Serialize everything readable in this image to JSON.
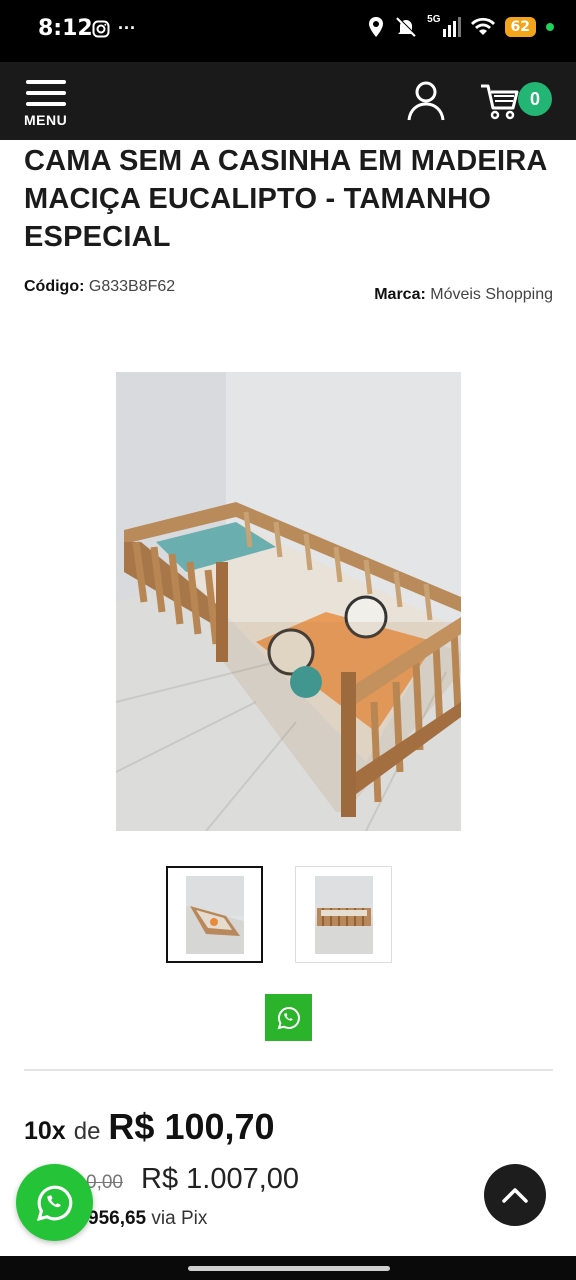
{
  "status_bar": {
    "time": "8:12",
    "network": "5G",
    "battery": "62",
    "overflow": "···"
  },
  "header": {
    "menu_label": "MENU",
    "cart_count": "0"
  },
  "product": {
    "title": "CAMA SEM A CASINHA EM MADEIRA MACIÇA EUCALIPTO - TAMANHO ESPECIAL",
    "code_label": "Código:",
    "code_value": "G833B8F62",
    "brand_label": "Marca:",
    "brand_value": "Móveis Shopping"
  },
  "pricing": {
    "installments_count": "10x",
    "installments_de": "de",
    "installments_value": "R$ 100,70",
    "old_price": "0,00",
    "new_price": "R$ 1.007,00",
    "pix_value": "956,65",
    "pix_suffix": "via Pix"
  },
  "colors": {
    "header_bg": "#1a1a1a",
    "cart_badge": "#22b573",
    "whatsapp": "#25c338"
  },
  "icons": {
    "menu": "hamburger-icon",
    "user": "user-icon",
    "cart": "cart-icon",
    "whatsapp": "whatsapp-icon",
    "scroll_top": "chevron-up-icon"
  }
}
